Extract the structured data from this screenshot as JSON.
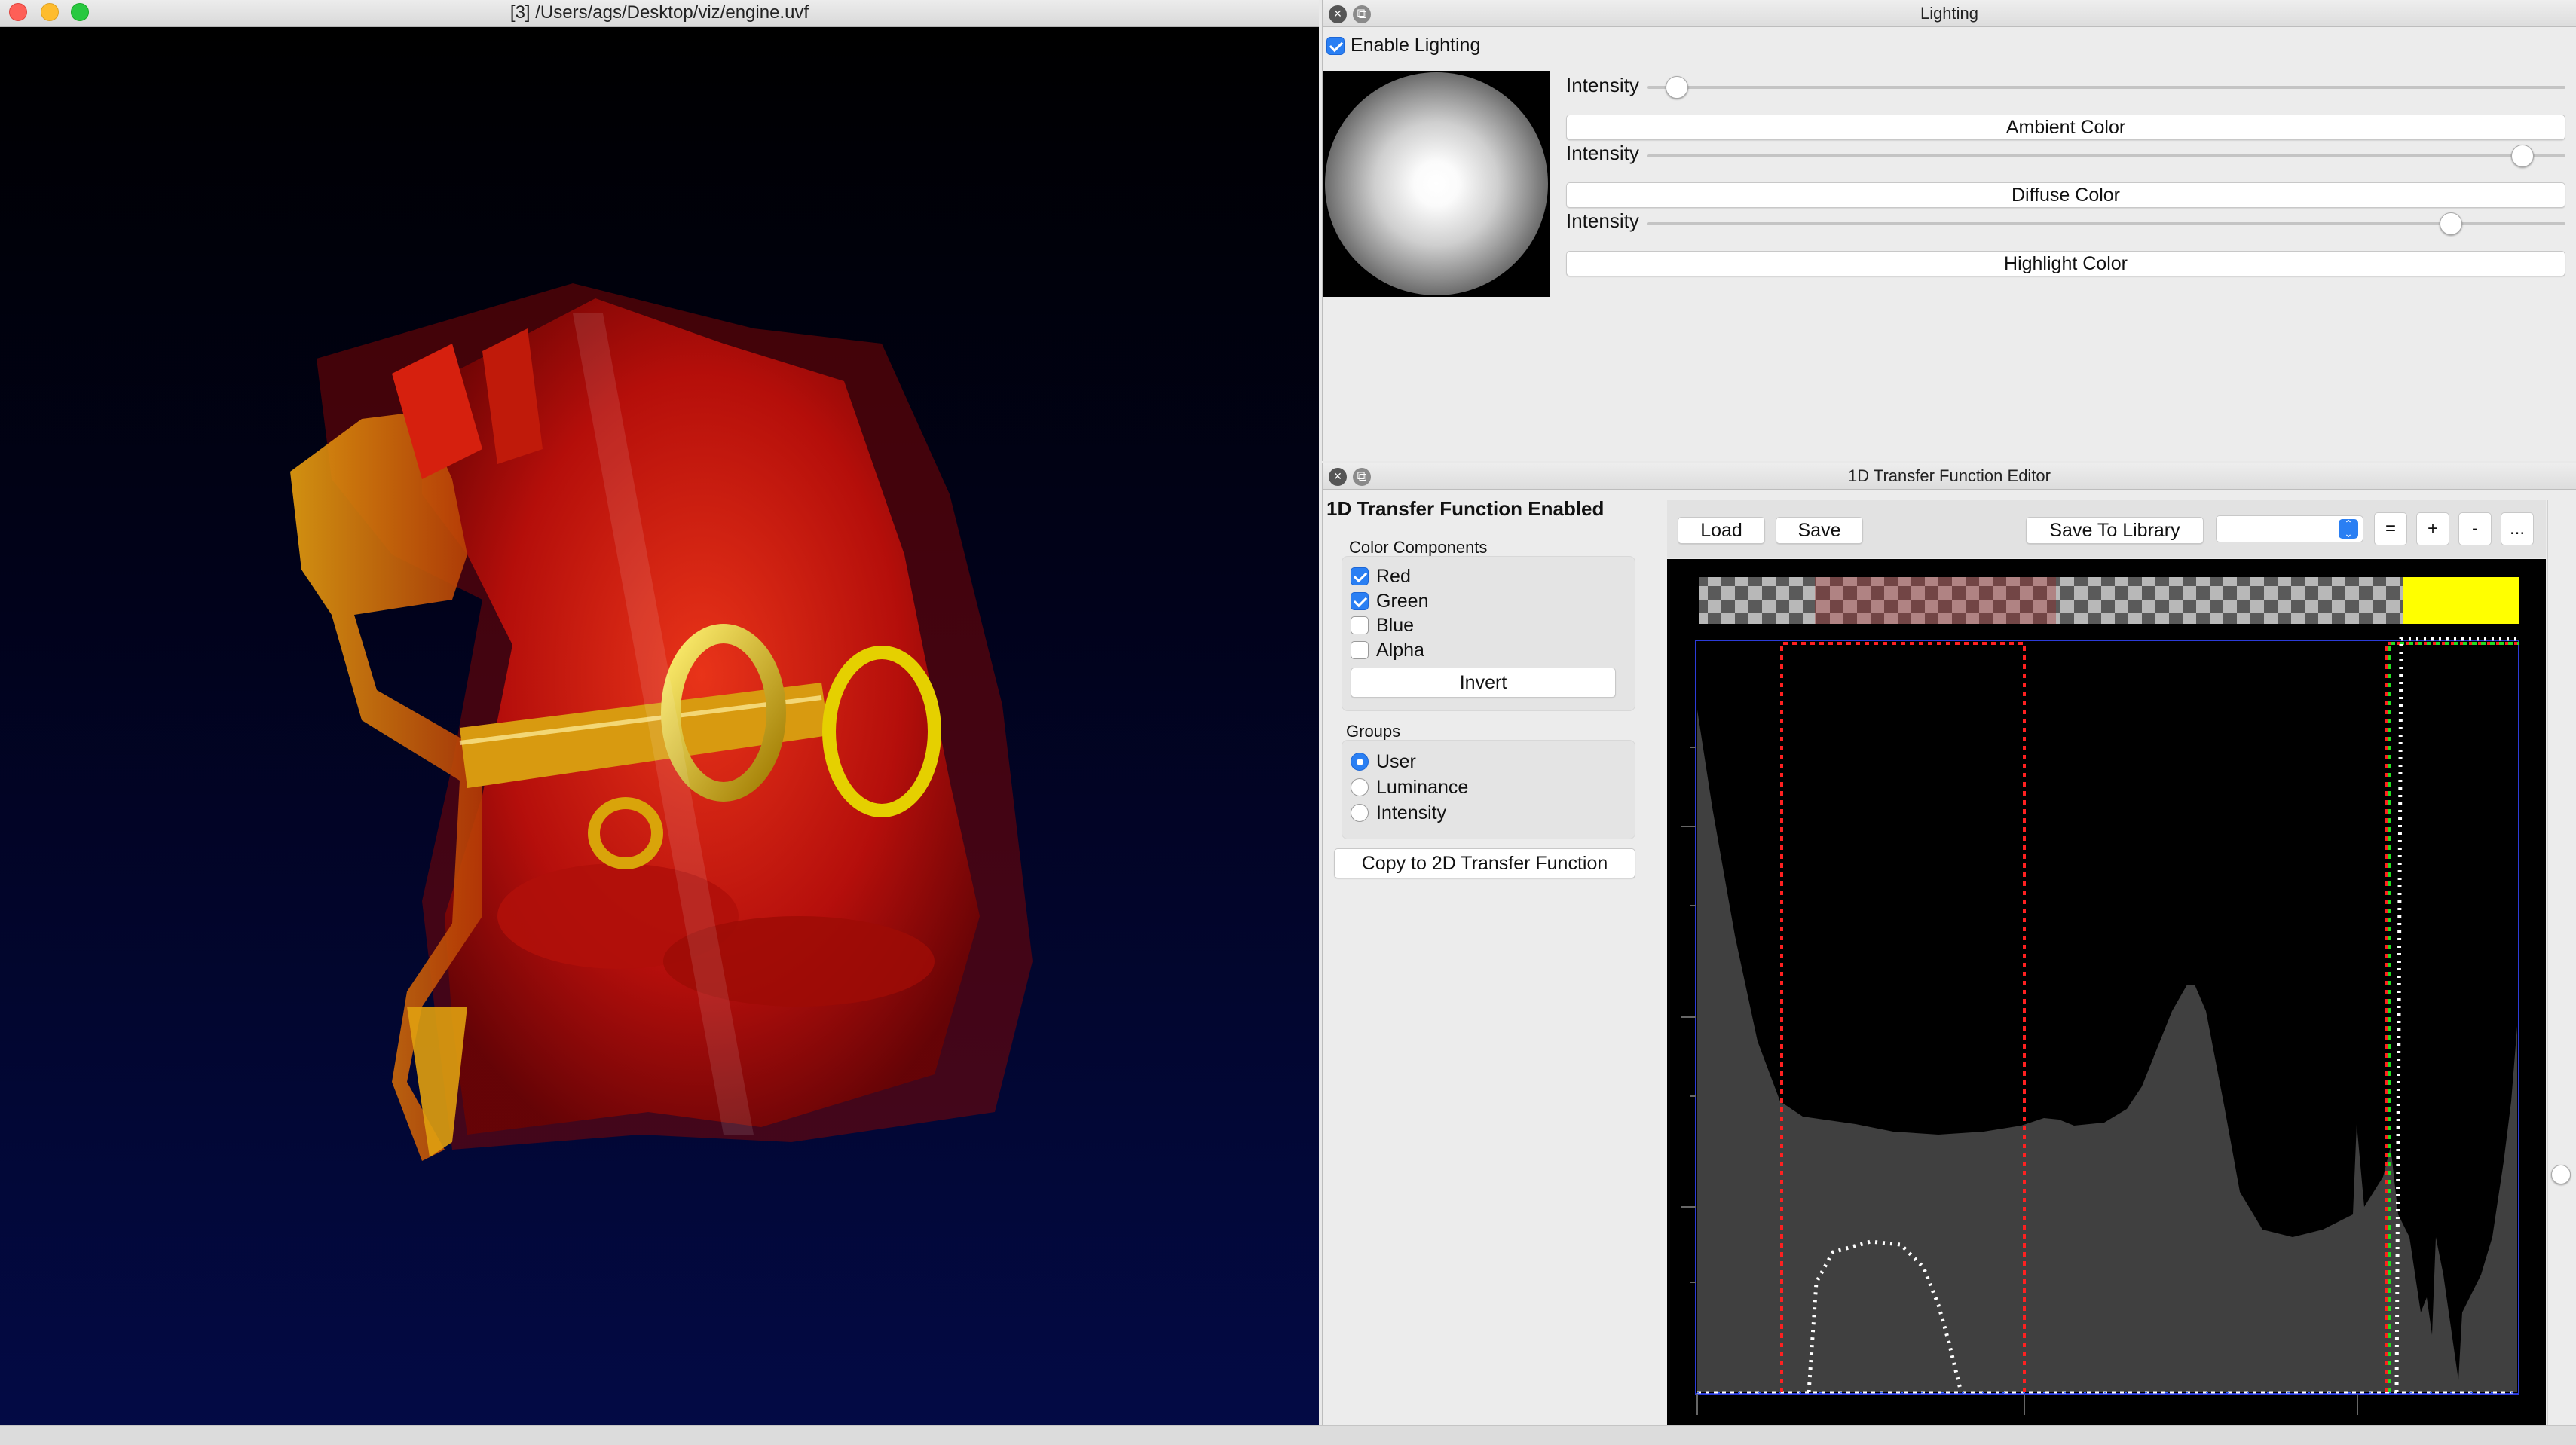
{
  "render_window": {
    "title": "[3] /Users/ags/Desktop/viz/engine.uvf"
  },
  "lighting": {
    "title": "Lighting",
    "enable_label": "Enable Lighting",
    "enabled": true,
    "intensity_label": "Intensity",
    "sliders": [
      {
        "label": "Intensity",
        "value": 0.02,
        "button": "Ambient Color"
      },
      {
        "label": "Intensity",
        "value": 0.965,
        "button": "Diffuse Color"
      },
      {
        "label": "Intensity",
        "value": 0.885,
        "button": "Highlight Color"
      }
    ]
  },
  "tf": {
    "title": "1D Transfer Function Editor",
    "enabled_label": "1D Transfer Function Enabled",
    "color_components_label": "Color Components",
    "components": [
      {
        "label": "Red",
        "checked": true
      },
      {
        "label": "Green",
        "checked": true
      },
      {
        "label": "Blue",
        "checked": false
      },
      {
        "label": "Alpha",
        "checked": false
      }
    ],
    "invert_label": "Invert",
    "groups_label": "Groups",
    "groups": [
      {
        "label": "User",
        "selected": true
      },
      {
        "label": "Luminance",
        "selected": false
      },
      {
        "label": "Intensity",
        "selected": false
      }
    ],
    "copy_label": "Copy to 2D Transfer Function",
    "toolbar": {
      "load": "Load",
      "save": "Save",
      "save_to_library": "Save To Library",
      "library_value": "",
      "equals": "=",
      "plus": "+",
      "minus": "-",
      "more": "..."
    }
  },
  "colors": {
    "accent": "#2a7ff3",
    "histogram": "#404040",
    "red_curve": "#ff2020",
    "green_curve": "#22dd22",
    "alpha_curve": "#ffffff",
    "swatch_yellow": "#ffff00"
  },
  "icons": {
    "close": "close-icon",
    "float": "float-icon",
    "dropdown": "updown-chevron-icon"
  }
}
